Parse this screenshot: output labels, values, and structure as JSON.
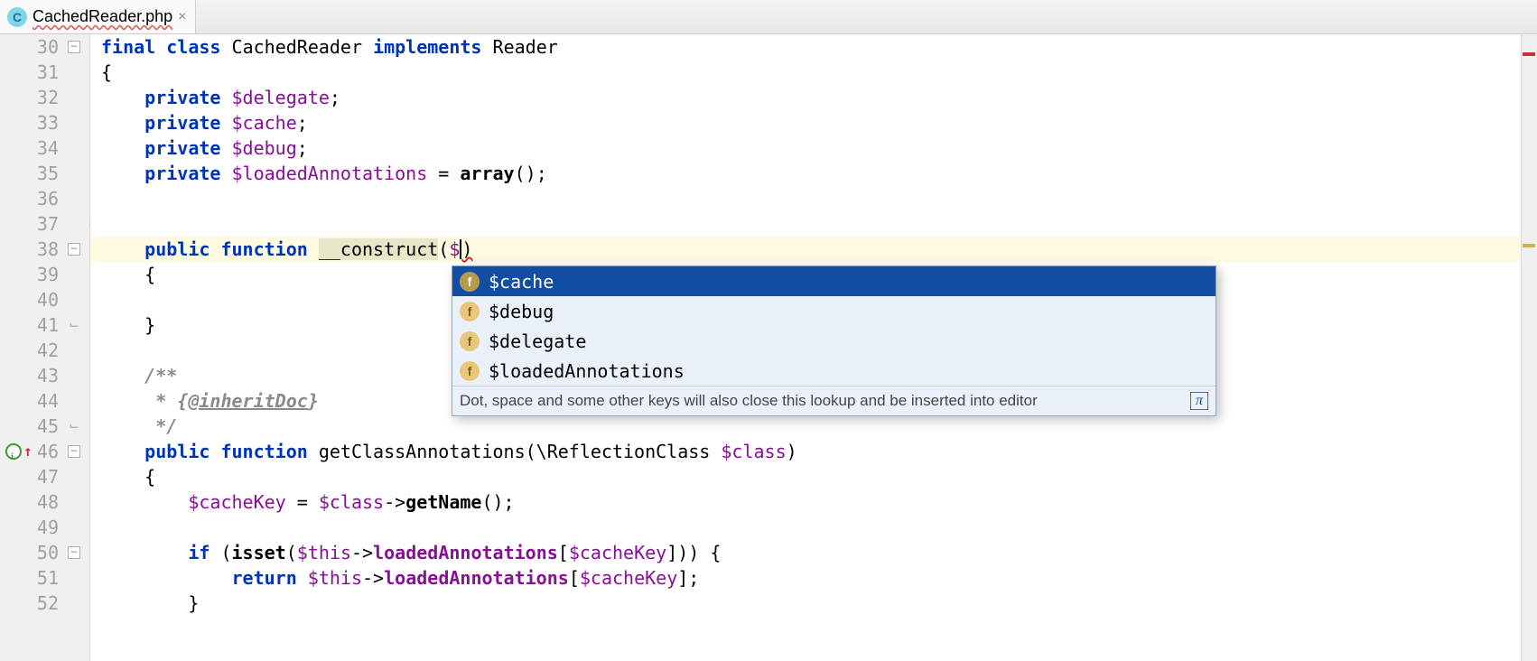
{
  "tab": {
    "filename": "CachedReader.php",
    "icon_letter": "C"
  },
  "lines": {
    "start": 30,
    "end": 52,
    "fold_open": [
      30,
      38,
      46,
      50
    ],
    "fold_close": [
      41,
      45
    ],
    "bulb_line": 37,
    "override_line": 46,
    "active_line": 38
  },
  "code": {
    "l30": {
      "kw_final": "final",
      "kw_class": "class",
      "cls": "CachedReader",
      "kw_impl": "implements",
      "iface": "Reader"
    },
    "l31": "{",
    "l32": {
      "kw": "private",
      "var": "$delegate"
    },
    "l33": {
      "kw": "private",
      "var": "$cache"
    },
    "l34": {
      "kw": "private",
      "var": "$debug"
    },
    "l35": {
      "kw": "private",
      "var": "$loadedAnnotations",
      "eq": "=",
      "fn": "array",
      "call": "();"
    },
    "l36": "",
    "l37": "",
    "l38": {
      "kw_pub": "public",
      "kw_fn": "function",
      "name": "__construct",
      "open": "(",
      "dollar": "$",
      "close": ")"
    },
    "l39": "{",
    "l40": "",
    "l41": "}",
    "l42": "",
    "l43": "/**",
    "l44": {
      "star": " * {",
      "ann": "@inheritDoc",
      "end": "}"
    },
    "l45": " */",
    "l46": {
      "kw_pub": "public",
      "kw_fn": "function",
      "name": "getClassAnnotations",
      "open": "(\\ReflectionClass ",
      "var": "$class",
      "close": ")"
    },
    "l47": "{",
    "l48": {
      "var": "$cacheKey",
      "eq": " = ",
      "v2": "$class",
      "arrow": "->",
      "m": "getName",
      "tail": "();"
    },
    "l49": "",
    "l50": {
      "kw": "if",
      "open": " (",
      "fn": "isset",
      "p": "(",
      "v": "$this",
      "arrow": "->",
      "prop": "loadedAnnotations",
      "br": "[",
      "key": "$cacheKey",
      "close": "])) {"
    },
    "l51": {
      "kw": "return",
      "sp": " ",
      "v": "$this",
      "arrow": "->",
      "prop": "loadedAnnotations",
      "br": "[",
      "key": "$cacheKey",
      "close": "];"
    },
    "l52": "}"
  },
  "autocomplete": {
    "items": [
      {
        "icon": "f",
        "label": "$cache",
        "selected": true
      },
      {
        "icon": "f",
        "label": "$debug",
        "selected": false
      },
      {
        "icon": "f",
        "label": "$delegate",
        "selected": false
      },
      {
        "icon": "f",
        "label": "$loadedAnnotations",
        "selected": false
      }
    ],
    "hint": "Dot, space and some other keys will also close this lookup and be inserted into editor",
    "pi": "π"
  }
}
